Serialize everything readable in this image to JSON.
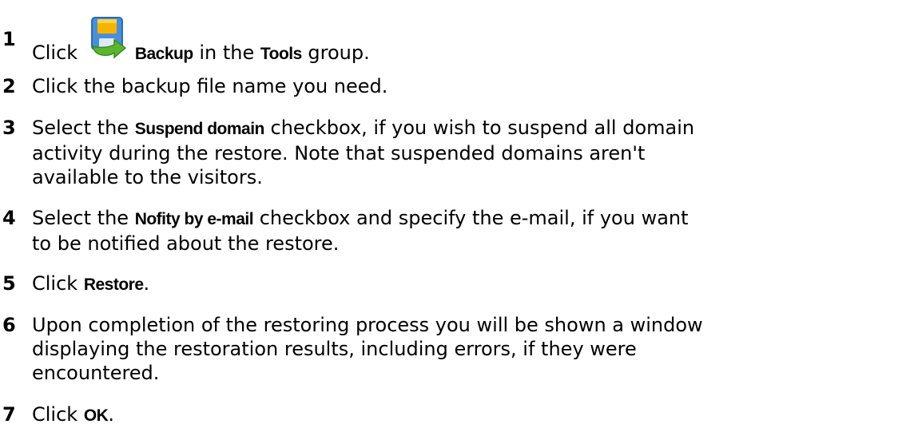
{
  "steps": [
    {
      "number": "1",
      "parts": [
        "Click ",
        "Backup",
        " in the ",
        "Tools",
        " group."
      ],
      "icon": "backup-icon"
    },
    {
      "number": "2",
      "text": "Click the backup file name you need."
    },
    {
      "number": "3",
      "pre": "Select the ",
      "bold": "Suspend domain",
      "line1_post": " checkbox, if you wish to suspend all domain",
      "line2": "activity during the restore. Note that suspended domains aren't",
      "line3": "available to the visitors."
    },
    {
      "number": "4",
      "pre": "Select the ",
      "bold": "Nofity by e-mail",
      "line1_post": " checkbox and specify the e-mail, if you want",
      "line2": "to be notified about the restore."
    },
    {
      "number": "5",
      "pre": "Click ",
      "bold": "Restore",
      "post": "."
    },
    {
      "number": "6",
      "line1": "Upon completion of the restoring process you will be shown a window",
      "line2": "displaying the restoration results, including errors, if they were",
      "line3": "encountered."
    },
    {
      "number": "7",
      "pre": "Click ",
      "bold": "OK",
      "post": "."
    }
  ],
  "colors": {
    "text": "#000000",
    "icon_floppy": "#f5b400",
    "icon_arrow": "#5cb531"
  }
}
